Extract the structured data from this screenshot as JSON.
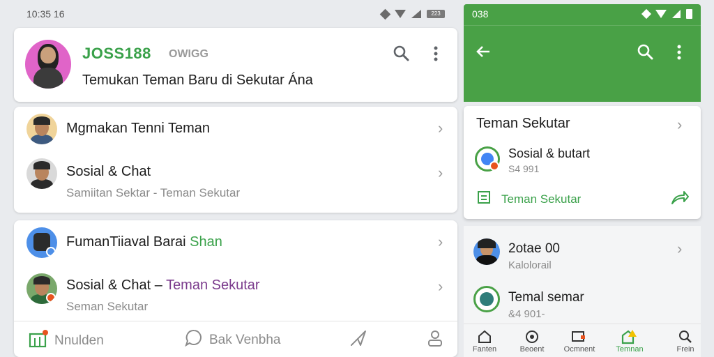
{
  "left": {
    "status": {
      "time": "10:35 16",
      "battery": "223"
    },
    "header": {
      "brand": "JOSS188",
      "brand_sub": "OWIGG",
      "tagline": "Temukan Teman Baru di Sekutar Ána"
    },
    "card1": [
      {
        "title": "Mgmakan Tenni Teman",
        "subtitle": ""
      },
      {
        "title": "Sosial & Chat",
        "subtitle": "Samiitan Sektar - Teman Sekutar"
      }
    ],
    "card2": [
      {
        "title_a": "FumanTiiaval Barai",
        "title_b": "Shan",
        "subtitle": ""
      },
      {
        "title_a": "Sosial & Chat –",
        "title_b": "Teman Sekutar",
        "subtitle": "Seman Sekutar"
      }
    ],
    "bottom_nav": {
      "item1": "Nnulden",
      "item2": "Bak Venbha"
    }
  },
  "right": {
    "status": {
      "time": "038"
    },
    "card": {
      "title": "Teman Sekutar",
      "item_title": "Sosial & butart",
      "item_sub": "S4 991",
      "link": "Teman Sekutar"
    },
    "list": [
      {
        "title": "2otae 00",
        "subtitle": "Kalolorail"
      },
      {
        "title": "Temal semar",
        "subtitle": "&4 901-"
      }
    ],
    "nav": [
      {
        "label": "Fanten",
        "icon": "home-icon"
      },
      {
        "label": "Beoent",
        "icon": "recent-icon"
      },
      {
        "label": "Ocmnent",
        "icon": "comment-icon"
      },
      {
        "label": "Temnan",
        "icon": "friends-icon"
      },
      {
        "label": "Frein",
        "icon": "search-icon"
      }
    ]
  },
  "colors": {
    "accent": "#3aa14a",
    "appbar": "#49a146",
    "purple": "#7a3a8c"
  }
}
